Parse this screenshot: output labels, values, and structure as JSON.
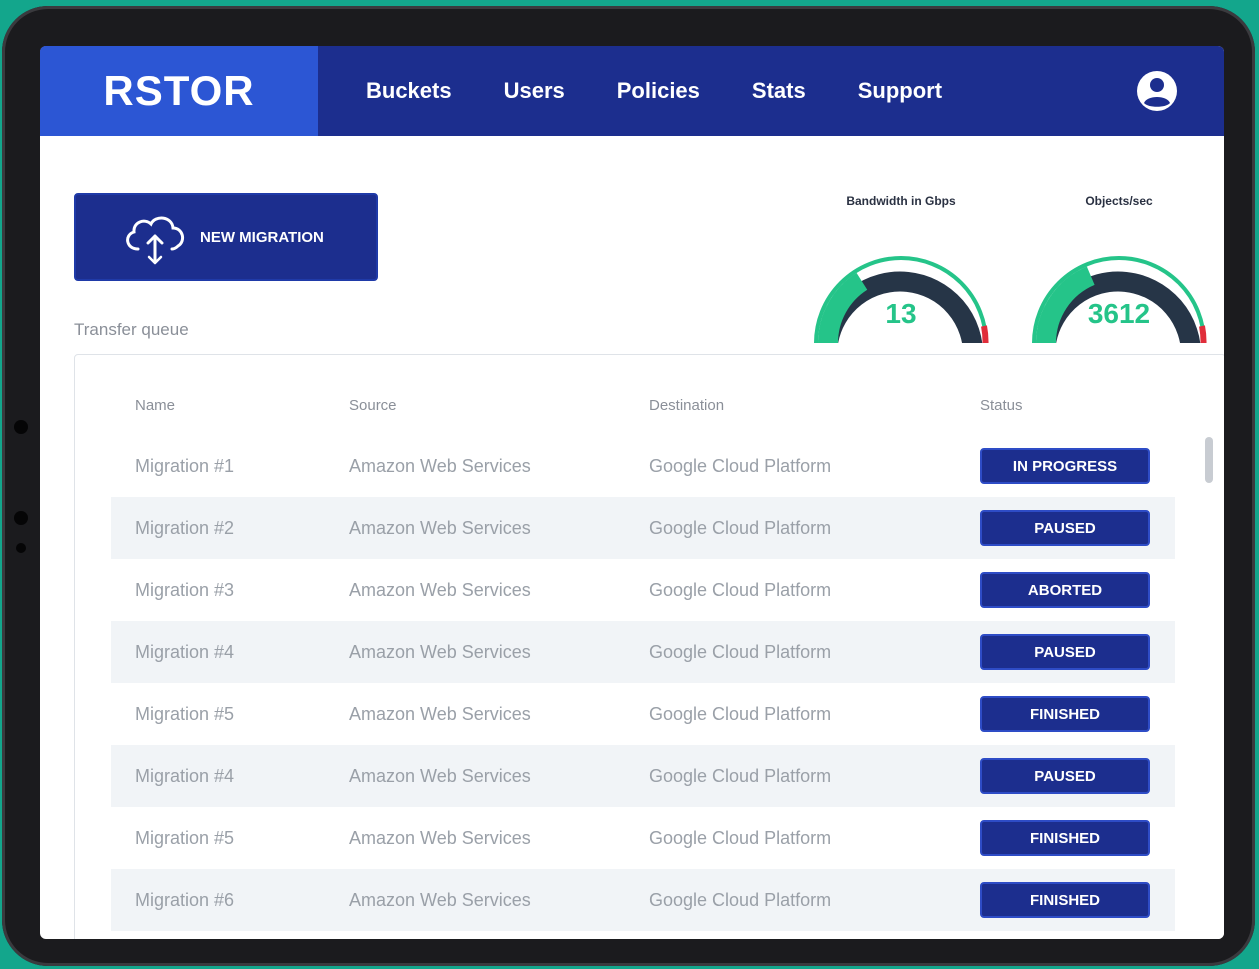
{
  "app": {
    "logo": "RSTOR"
  },
  "nav": {
    "items": [
      "Buckets",
      "Users",
      "Policies",
      "Stats",
      "Support"
    ]
  },
  "toolbar": {
    "new_migration_label": "NEW MIGRATION"
  },
  "gauges": [
    {
      "title": "Bandwidth in Gbps",
      "value": "13",
      "level": 0.3
    },
    {
      "title": "Objects/sec",
      "value": "3612",
      "level": 0.35
    }
  ],
  "transfer_queue": {
    "label": "Transfer queue",
    "columns": [
      "Name",
      "Source",
      "Destination",
      "Status"
    ],
    "rows": [
      {
        "name": "Migration #1",
        "source": "Amazon Web Services",
        "destination": "Google Cloud Platform",
        "status": "IN PROGRESS"
      },
      {
        "name": "Migration #2",
        "source": "Amazon Web Services",
        "destination": "Google Cloud Platform",
        "status": "PAUSED"
      },
      {
        "name": "Migration #3",
        "source": "Amazon Web Services",
        "destination": "Google Cloud Platform",
        "status": "ABORTED"
      },
      {
        "name": "Migration #4",
        "source": "Amazon Web Services",
        "destination": "Google Cloud Platform",
        "status": "PAUSED"
      },
      {
        "name": "Migration #5",
        "source": "Amazon Web Services",
        "destination": "Google Cloud Platform",
        "status": "FINISHED"
      },
      {
        "name": "Migration #4",
        "source": "Amazon Web Services",
        "destination": "Google Cloud Platform",
        "status": "PAUSED"
      },
      {
        "name": "Migration #5",
        "source": "Amazon Web Services",
        "destination": "Google Cloud Platform",
        "status": "FINISHED"
      },
      {
        "name": "Migration #6",
        "source": "Amazon Web Services",
        "destination": "Google Cloud Platform",
        "status": "FINISHED"
      }
    ]
  },
  "colors": {
    "nav_bg": "#1c2e8e",
    "logo_bg": "#2c56d4",
    "gauge_green": "#25c489",
    "gauge_dark": "#263547",
    "gauge_red": "#e02d3a",
    "page_bg": "#13a68c"
  }
}
